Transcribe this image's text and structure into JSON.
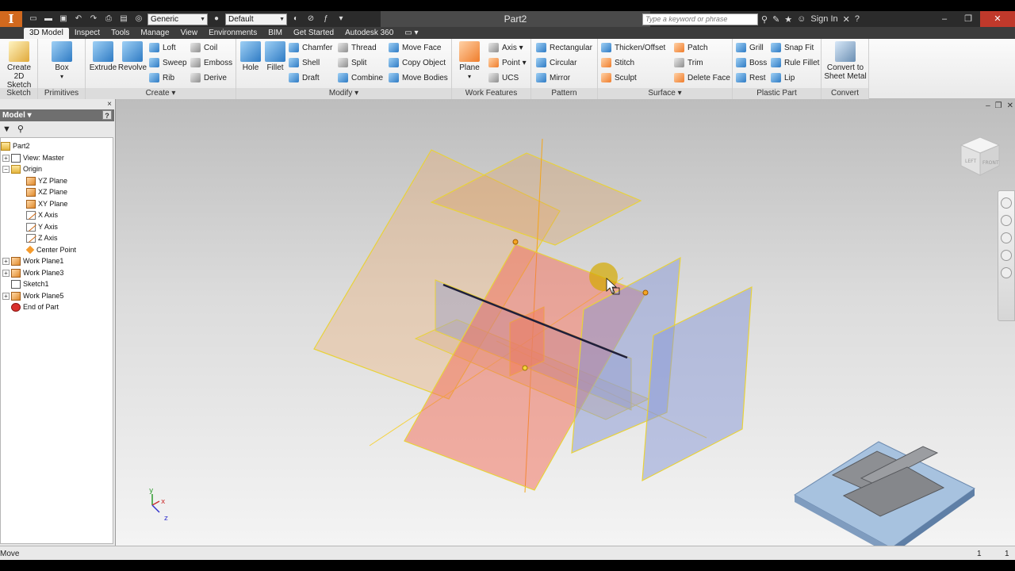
{
  "app": {
    "logo_letter": "I",
    "document_title": "Part2",
    "search_placeholder": "Type a keyword or phrase",
    "sign_in": "Sign In"
  },
  "quick_access": {
    "appearance_value": "Generic",
    "material_value": "Default"
  },
  "tabs": [
    "3D Model",
    "Inspect",
    "Tools",
    "Manage",
    "View",
    "Environments",
    "BIM",
    "Get Started",
    "Autodesk 360"
  ],
  "ribbon": {
    "groups": [
      {
        "label": "Sketch"
      },
      {
        "label": "Primitives"
      },
      {
        "label": "Create"
      },
      {
        "label": "Modify"
      },
      {
        "label": "Work Features"
      },
      {
        "label": "Pattern"
      },
      {
        "label": "Surface"
      },
      {
        "label": "Plastic Part"
      },
      {
        "label": "Convert"
      }
    ],
    "sketch": {
      "create_2d_sketch": "Create\n2D Sketch"
    },
    "primitives": {
      "box": "Box"
    },
    "create": {
      "extrude": "Extrude",
      "revolve": "Revolve",
      "loft": "Loft",
      "sweep": "Sweep",
      "rib": "Rib",
      "coil": "Coil",
      "emboss": "Emboss",
      "derive": "Derive"
    },
    "modify": {
      "hole": "Hole",
      "fillet": "Fillet",
      "chamfer": "Chamfer",
      "shell": "Shell",
      "draft": "Draft",
      "thread": "Thread",
      "split": "Split",
      "combine": "Combine",
      "move_face": "Move Face",
      "copy_object": "Copy Object",
      "move_bodies": "Move Bodies"
    },
    "work_features": {
      "plane": "Plane",
      "axis": "Axis",
      "point": "Point",
      "ucs": "UCS"
    },
    "pattern": {
      "rectangular": "Rectangular",
      "circular": "Circular",
      "mirror": "Mirror"
    },
    "surface": {
      "thicken_offset": "Thicken/Offset",
      "stitch": "Stitch",
      "sculpt": "Sculpt",
      "patch": "Patch",
      "trim": "Trim",
      "delete_face": "Delete Face"
    },
    "plastic_part": {
      "grill": "Grill",
      "boss": "Boss",
      "rest": "Rest",
      "snap_fit": "Snap Fit",
      "rule_fillet": "Rule Fillet",
      "lip": "Lip"
    },
    "convert": {
      "convert_to_sheet_metal": "Convert to\nSheet Metal"
    }
  },
  "browser": {
    "title": "Model",
    "help": "?",
    "close": "×",
    "tree": [
      {
        "label": "Part2"
      },
      {
        "label": "View: Master"
      },
      {
        "label": "Origin"
      },
      {
        "label": "YZ Plane"
      },
      {
        "label": "XZ Plane"
      },
      {
        "label": "XY Plane"
      },
      {
        "label": "X Axis"
      },
      {
        "label": "Y Axis"
      },
      {
        "label": "Z Axis"
      },
      {
        "label": "Center Point"
      },
      {
        "label": "Work Plane1"
      },
      {
        "label": "Work Plane3"
      },
      {
        "label": "Sketch1"
      },
      {
        "label": "Work Plane5"
      },
      {
        "label": "End of Part"
      }
    ]
  },
  "viewcube": {
    "left_face": "LEFT",
    "front_face": "FRONT"
  },
  "triad": {
    "x": "x",
    "y": "y",
    "z": "z"
  },
  "statusbar": {
    "text": "Move",
    "left_count": "1",
    "right_count": "1"
  },
  "colors": {
    "workplane_fill": "#f0a862",
    "workplane_edge": "#e8d23a",
    "selected_plane": "#f36b56",
    "blue_plane": "#8898d6",
    "accent_orange": "#d2691e"
  }
}
